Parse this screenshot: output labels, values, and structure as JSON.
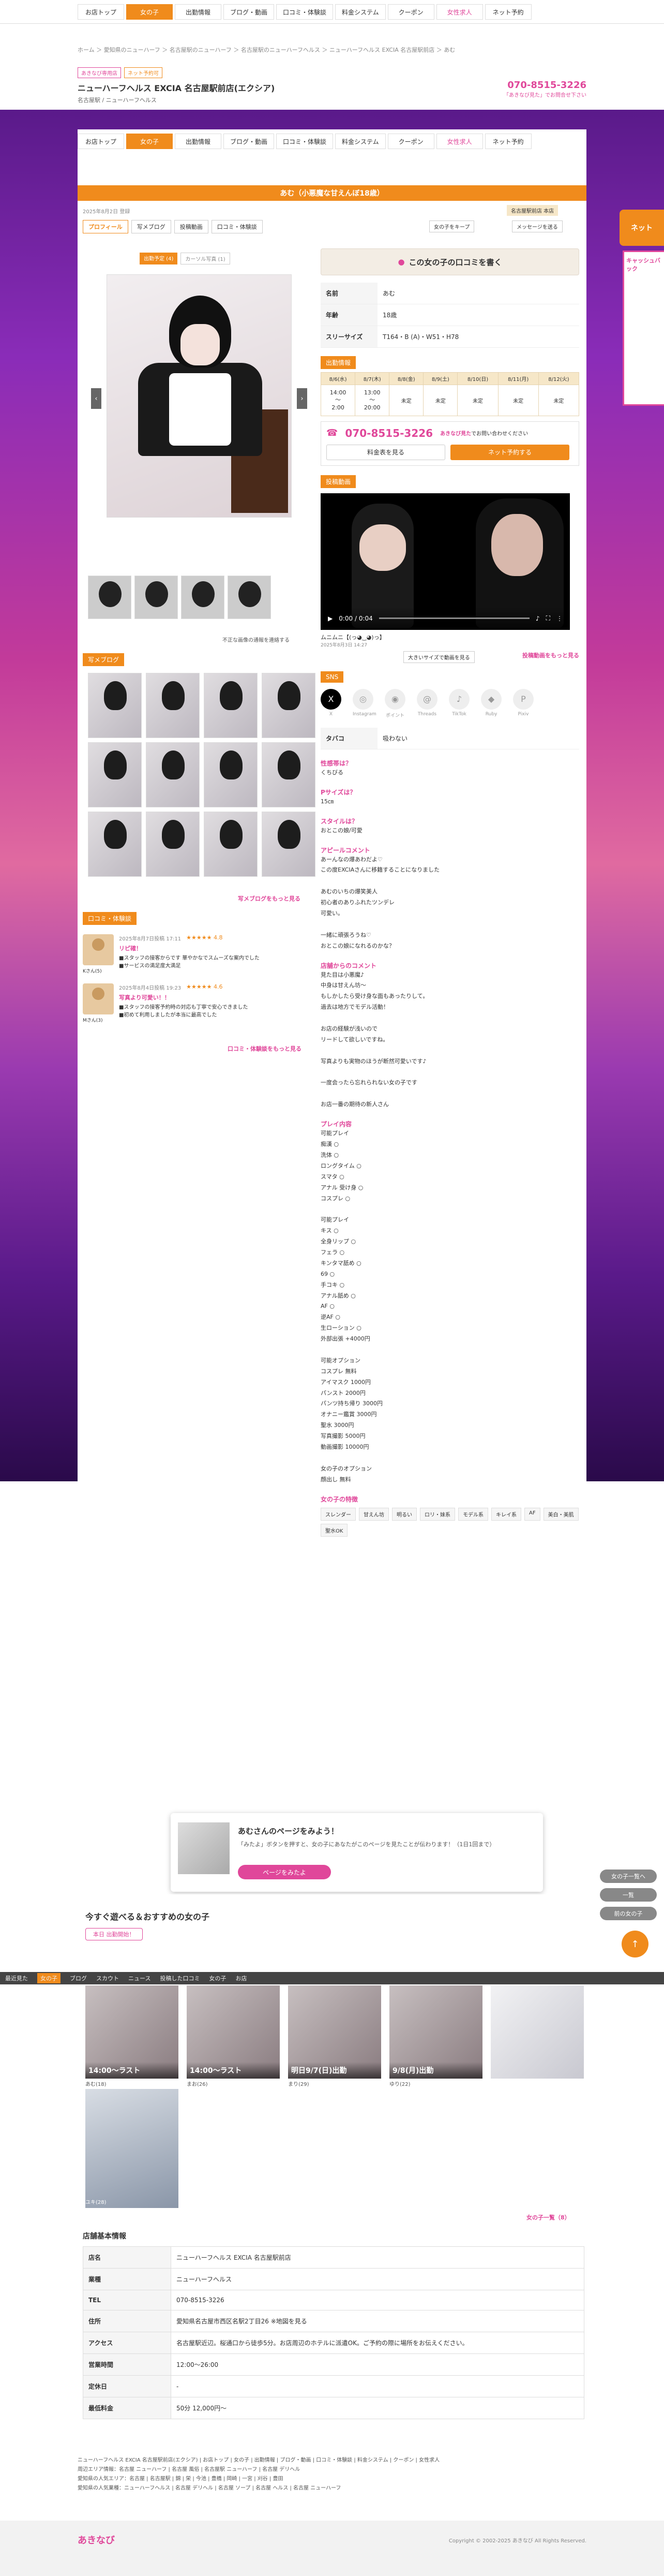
{
  "nav": {
    "items": [
      "お店トップ",
      "女の子",
      "出勤情報",
      "ブログ・動画",
      "口コミ・体験談",
      "料金システム",
      "クーポン",
      "女性求人",
      "ネット予約"
    ]
  },
  "breadcrumb": "ホーム ＞ 愛知県のニューハーフ ＞ 名古屋駅のニューハーフ ＞ 名古屋駅のニューハーフヘルス ＞ ニューハーフヘルス EXCIA 名古屋駅前店 ＞ あむ",
  "shop": {
    "badge1": "あきなび専用店",
    "badge2": "ネット予約可",
    "name": "ニューハーフヘルス EXCIA 名古屋駅前店(エクシア)",
    "area": "名古屋駅 / ニューハーフヘルス",
    "tel": "070-8515-3226",
    "tel_note": "「あきなび見た」でお問合せ下さい"
  },
  "girl": {
    "title": "あむ（小悪魔な甘えんぼ18歳）",
    "updated": "2025年8月2日 登録",
    "shopname_badge": "名古屋駅前店 本店",
    "keep": "女の子をキープ",
    "msg": "メッセージを送る"
  },
  "tabs": [
    "プロフィール",
    "写メブログ",
    "投稿動画",
    "口コミ・体験談"
  ],
  "photo_tabs": [
    "出勤予定 (4)",
    "カーソル写真 (1)"
  ],
  "photo_note": "不正な画像の通報を連絡する",
  "profile": {
    "kuchi": "この女の子の口コミを書く",
    "rows": [
      {
        "k": "名前",
        "v": "あむ"
      },
      {
        "k": "年齢",
        "v": "18歳"
      },
      {
        "k": "スリーサイズ",
        "v": "T164・B (A)・W51・H78"
      }
    ]
  },
  "schedule": {
    "title": "出勤情報",
    "days": [
      "8/6(水)",
      "8/7(木)",
      "8/8(金)",
      "8/9(土)",
      "8/10(日)",
      "8/11(月)",
      "8/12(火)"
    ],
    "vals": [
      "14:00\n〜\n2:00",
      "13:00\n〜\n20:00",
      "未定",
      "未定",
      "未定",
      "未定",
      "未定"
    ]
  },
  "tel": {
    "num": "070-8515-3226",
    "note": "あきなび見た",
    "note2": "でお問い合わせください",
    "price_btn": "料金表を見る",
    "net_btn": "ネット予約する"
  },
  "video": {
    "title": "投稿動画",
    "time": "0:00 / 0:04",
    "caption": "ムニムニ【(っ◕‿◕)っ】",
    "date": "2025年8月3日 14:27",
    "fullsize": "大きいサイズで動画を見る",
    "more": "投稿動画をもっと見る"
  },
  "sns": {
    "title": "SNS",
    "items": [
      "X",
      "Instagram",
      "ポイント",
      "Threads",
      "TikTok",
      "Ruby",
      "Pixiv"
    ],
    "icons": [
      "x-icon",
      "instagram-icon",
      "point-icon",
      "threads-icon",
      "tiktok-icon",
      "ruby-icon",
      "pixiv-icon"
    ]
  },
  "qa": [
    {
      "q": "タバコ",
      "a": "吸わない"
    },
    {
      "q": "性感帯は？",
      "a": "くちびる"
    },
    {
      "q": "Pサイズは？",
      "a": "15㎝"
    },
    {
      "q": "スタイルは？",
      "a": "おとこの娘/可愛"
    }
  ],
  "appeal_title": "アピールコメント",
  "appeal": "あーんなの爆あわだよ♡\nこの度EXCIAさんに移籍することになりました\n\nあむのいちの爆笑美人\n初心者のありふれたツンデレ\n可愛い。\n\n一緒に頑張ろうね♡\nおとこの娘になれるのかな？",
  "shop_comment_title": "店舗からのコメント",
  "shop_comment": "見た目は小悪魔♪\n中身は甘えん坊〜\nもしかしたら受け身な面もあったりして。\n過去は地方でモデル活動！\n\nお店の経験が浅いので\nリードして欲しいですね。\n\n写真よりも実物のほうが断然可愛いです♪\n\n一度会ったら忘れられない女の子です\n\nお店一番の期待の新人さん",
  "plays_title": "プレイ内容",
  "plays": "可能プレイ\n痴漢 ○\n洗体 ○\nロングタイム ○\nスマタ ○\nアナル 受け身 ○\nコスプレ ○\n\n可能プレイ\nキス ○\n全身リップ ○\nフェラ ○\nキンタマ舐め ○\n69 ○\n手コキ ○\nアナル舐め ○\nAF ○\n逆AF ○\n生ローション ○\n外部出張 +4000円\n\n可能オプション\nコスプレ 無料\nアイマスク 1000円\nパンスト 2000円\nパンツ持ち帰り 3000円\nオナニー鑑賞 3000円\n聖水 3000円\n写真撮影 5000円\n動画撮影 10000円\n\n女の子のオプション\n顔出し 無料",
  "char_title": "女の子の特徴",
  "tags": [
    "スレンダー",
    "甘えん坊",
    "明るい",
    "ロリ・妹系",
    "モデル系",
    "キレイ系",
    "AF",
    "美白・美肌",
    "聖水OK"
  ],
  "blog_title": "写メブログ",
  "blog_more": "写メブログをもっと見る",
  "review_title": "口コミ・体験談",
  "reviews": [
    {
      "date": "2025年8月7日投稿 17:11",
      "stars": "★★★★★ 4.8",
      "title": "リピ確！",
      "body": "■スタッフの接客からです 華やかなでスムーズな案内でした\n■サービスの満足度大満足",
      "user": "Kさん(5)"
    },
    {
      "date": "2025年8月4日投稿 19:23",
      "stars": "★★★★★ 4.6",
      "title": "写真より可愛い！！",
      "body": "■スタッフの接客予約時の対応も丁寧で安心できました\n■初めて利用しましたが本当に最高でした",
      "user": "Mさん(3)"
    }
  ],
  "review_more": "口コミ・体験談をもっと見る",
  "card": {
    "title": "あむさんのページをみよう！",
    "body": "「みたよ」ボタンを押すと、女の子にあなたがこのページを見たことが伝わります！（1日1回まで）",
    "btn": "ページをみたよ"
  },
  "today_title": "今すぐ遊べる＆おすすめの女の子",
  "today_badge": "本日 出勤開始！",
  "bottombar": [
    "最近見た",
    "女の子",
    "ブログ",
    "スカウト",
    "ニュース",
    "投稿した口コミ",
    "女の子",
    "お店"
  ],
  "girls": [
    {
      "cap": "14:00〜ラスト",
      "name": "あむ(18)"
    },
    {
      "cap": "14:00〜ラスト",
      "name": "まお(26)"
    },
    {
      "cap": "明日9/7(日)出勤",
      "name": "まり(29)"
    },
    {
      "cap": "9/8(月)出勤",
      "name": "ゆり(22)"
    },
    {
      "cap": "",
      "name": "ユキ(28)"
    }
  ],
  "more_girls": "女の子一覧（8）",
  "shopinfo_title": "店舗基本情報",
  "shopinfo": [
    {
      "k": "店名",
      "v": "ニューハーフヘルス EXCIA 名古屋駅前店"
    },
    {
      "k": "業種",
      "v": "ニューハーフヘルス"
    },
    {
      "k": "TEL",
      "v": "070-8515-3226"
    },
    {
      "k": "住所",
      "v": "愛知県名古屋市西区名駅2丁目26 ※地図を見る"
    },
    {
      "k": "アクセス",
      "v": "名古屋駅近辺。桜通口から徒歩5分。お店周辺のホテルに派遣OK。ご予約の際に場所をお伝えください。"
    },
    {
      "k": "営業時間",
      "v": "12:00〜26:00"
    },
    {
      "k": "定休日",
      "v": "-"
    },
    {
      "k": "最低料金",
      "v": "50分 12,000円〜"
    }
  ],
  "footer": "ニューハーフヘルス EXCIA 名古屋駅前店(エクシア) | お店トップ | 女の子 | 出勤情報 | ブログ・動画 | 口コミ・体験談 | 料金システム | クーポン | 女性求人\n周辺エリア情報：名古屋 ニューハーフ | 名古屋 風俗 | 名古屋駅 ニューハーフ | 名古屋 デリヘル\n愛知県の人気エリア：名古屋 | 名古屋駅 | 錦 | 栄 | 今池 | 豊橋 | 岡崎 | 一宮 | 刈谷 | 豊田\n愛知県の人気業種：ニューハーフヘルス | 名古屋 デリヘル | 名古屋 ソープ | 名古屋 ヘルス | 名古屋 ニューハーフ",
  "copyright": "Copyright © 2002-2025 あきなび All Rights Reserved.",
  "logo": "あきなび",
  "side": {
    "net": "ネット",
    "recruit": "キャッシュバック",
    "back": "女の子一覧へ",
    "list": "一覧",
    "next": "前の女の子"
  }
}
